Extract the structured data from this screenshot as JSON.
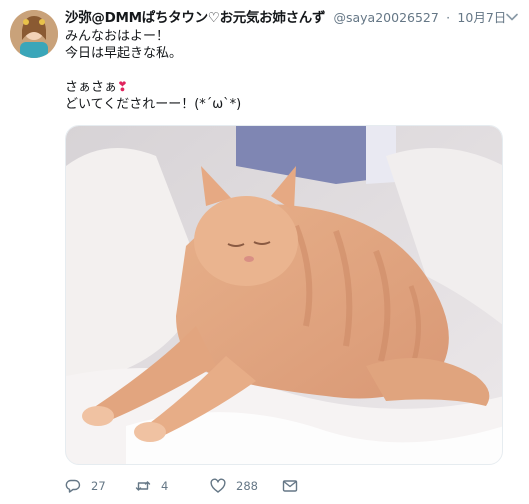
{
  "tweet": {
    "display_name": "沙弥@DMMぱちタウン♡お元気お姉さんず",
    "handle": "@saya20026527",
    "separator": "·",
    "date": "10月7日",
    "lines": [
      "みんなおはよー！",
      "今日は早起きな私。",
      "",
      "さぁさぁ",
      "どいてくだされーー！(*´ω`*)"
    ],
    "emoji": "❣",
    "reply_count": "27",
    "retweet_count": "4",
    "like_count": "288"
  },
  "icons": {
    "caret": "chevron-down-icon",
    "reply": "reply-icon",
    "retweet": "retweet-icon",
    "like": "heart-icon",
    "dm": "envelope-icon"
  },
  "colors": {
    "text": "#14171a",
    "secondary": "#657786",
    "emoji": "#e0245e"
  }
}
